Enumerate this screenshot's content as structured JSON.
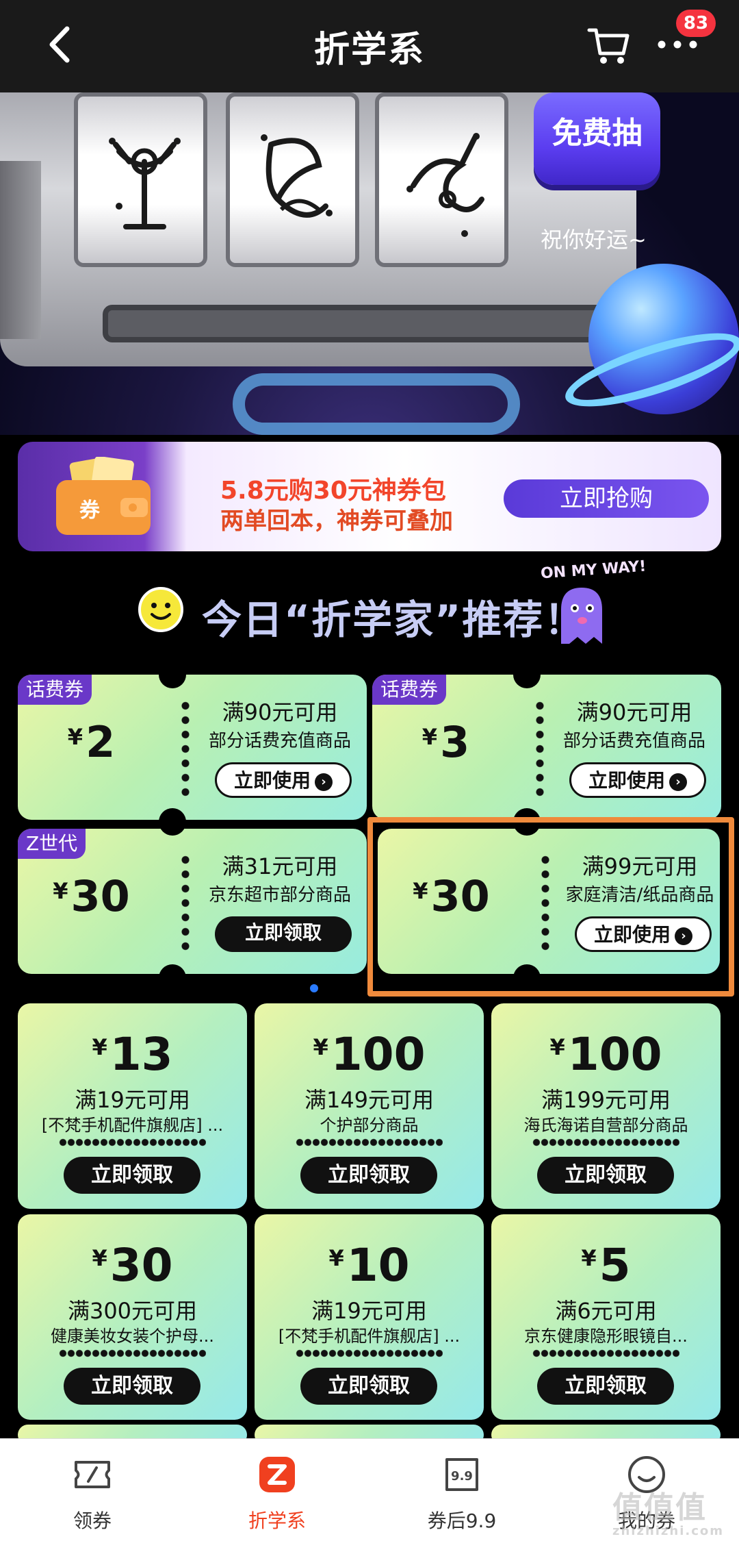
{
  "header": {
    "title": "折学系",
    "badge_count": "83"
  },
  "slot_banner": {
    "free_draw": "免费抽",
    "good_luck": "祝你好运~"
  },
  "package_banner": {
    "title": "5.8元购30元神券包",
    "subtitle": "两单回本，神券可叠加",
    "button": "立即抢购",
    "wallet_text": "券"
  },
  "section": {
    "heading": "今日“折学家”推荐！",
    "sticker": "ON MY WAY!"
  },
  "top_coupons": [
    {
      "tag": "话费券",
      "currency": "¥",
      "amount": "2",
      "condition": "满90元可用",
      "desc": "部分话费充值商品",
      "button": "立即使用"
    },
    {
      "tag": "话费券",
      "currency": "¥",
      "amount": "3",
      "condition": "满90元可用",
      "desc": "部分话费充值商品",
      "button": "立即使用"
    },
    {
      "tag": "Z世代",
      "currency": "¥",
      "amount": "30",
      "condition": "满31元可用",
      "desc": "京东超市部分商品",
      "button": "立即领取"
    },
    {
      "tag": "",
      "currency": "¥",
      "amount": "30",
      "condition": "满99元可用",
      "desc": "家庭清洁/纸品商品",
      "button": "立即使用"
    }
  ],
  "grid_coupons": [
    {
      "currency": "¥",
      "amount": "13",
      "condition": "满19元可用",
      "desc": "[不梵手机配件旗舰店] ...",
      "button": "立即领取"
    },
    {
      "currency": "¥",
      "amount": "100",
      "condition": "满149元可用",
      "desc": "个护部分商品",
      "button": "立即领取"
    },
    {
      "currency": "¥",
      "amount": "100",
      "condition": "满199元可用",
      "desc": "海氏海诺自营部分商品",
      "button": "立即领取"
    },
    {
      "currency": "¥",
      "amount": "30",
      "condition": "满300元可用",
      "desc": "健康美妆女装个护母...",
      "button": "立即领取"
    },
    {
      "currency": "¥",
      "amount": "10",
      "condition": "满19元可用",
      "desc": "[不梵手机配件旗舰店] ...",
      "button": "立即领取"
    },
    {
      "currency": "¥",
      "amount": "5",
      "condition": "满6元可用",
      "desc": "京东健康隐形眼镜自...",
      "button": "立即领取"
    }
  ],
  "bottom_nav": [
    {
      "label": "领券",
      "icon": "ticket-icon"
    },
    {
      "label": "折学系",
      "icon": "z-logo-icon"
    },
    {
      "label": "券后9.9",
      "icon": "price-tag-icon",
      "icon_text": "9.9"
    },
    {
      "label": "我的券",
      "icon": "smiley-icon"
    }
  ],
  "watermark": {
    "main": "值值值",
    "sub": "zhizhizhi.com"
  },
  "colors": {
    "accent": "#f0401f",
    "highlight": "#ef8a3c",
    "tag_purple": "#6a38c8",
    "button_purple": "#5a3ad8"
  }
}
